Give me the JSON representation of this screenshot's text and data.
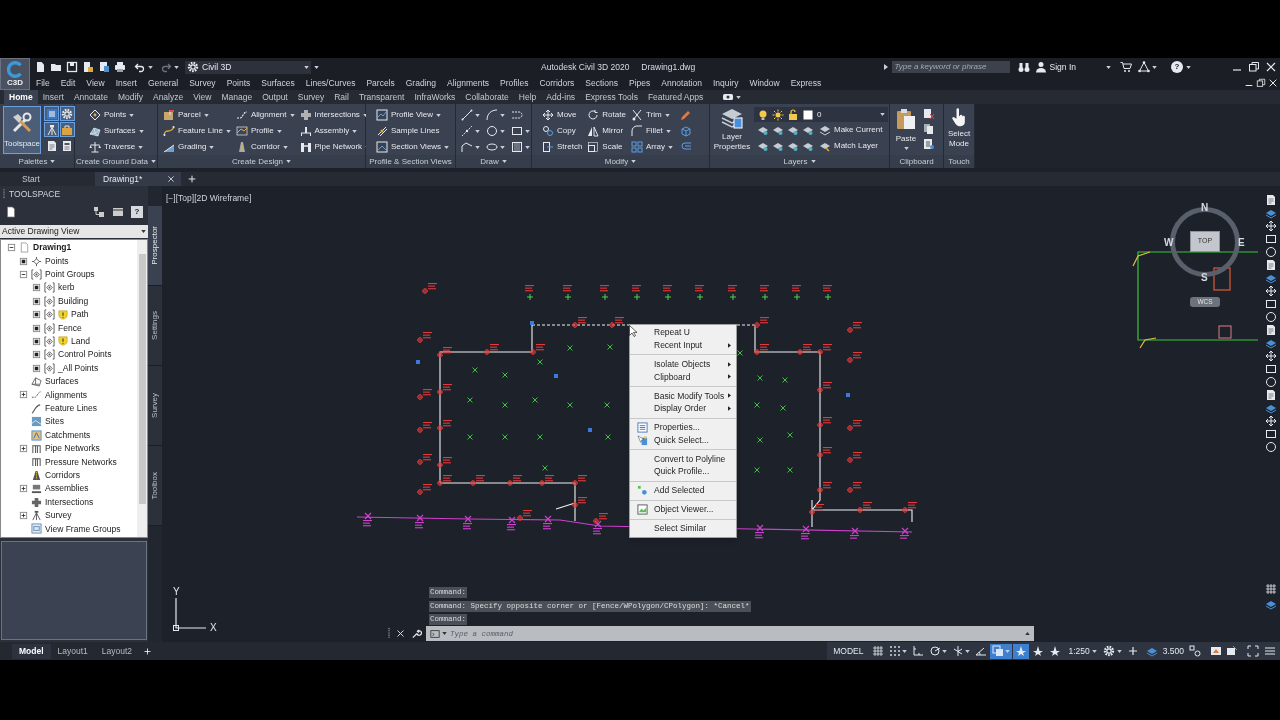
{
  "title_bar": {
    "app_button": "C3D",
    "workspace": "Civil 3D",
    "title": "Autodesk Civil 3D 2020",
    "document": "Drawing1.dwg",
    "search": {
      "placeholder": "Type a keyword or phrase"
    },
    "sign_in": "Sign In",
    "help": "?"
  },
  "menu_bar": [
    "File",
    "Edit",
    "View",
    "Insert",
    "General",
    "Survey",
    "Points",
    "Surfaces",
    "Lines/Curves",
    "Parcels",
    "Grading",
    "Alignments",
    "Profiles",
    "Corridors",
    "Sections",
    "Pipes",
    "Annotation",
    "Inquiry",
    "Window",
    "Express"
  ],
  "ribbon_tabs": [
    {
      "label": "Home",
      "selected": true
    },
    {
      "label": "Insert",
      "selected": false
    },
    {
      "label": "Annotate",
      "selected": false
    },
    {
      "label": "Modify",
      "selected": false
    },
    {
      "label": "Analyze",
      "selected": false
    },
    {
      "label": "View",
      "selected": false
    },
    {
      "label": "Manage",
      "selected": false
    },
    {
      "label": "Output",
      "selected": false
    },
    {
      "label": "Survey",
      "selected": false
    },
    {
      "label": "Rail",
      "selected": false
    },
    {
      "label": "Transparent",
      "selected": false
    },
    {
      "label": "InfraWorks",
      "selected": false
    },
    {
      "label": "Collaborate",
      "selected": false
    },
    {
      "label": "Help",
      "selected": false
    },
    {
      "label": "Add-ins",
      "selected": false
    },
    {
      "label": "Express Tools",
      "selected": false
    },
    {
      "label": "Featured Apps",
      "selected": false
    }
  ],
  "ribbon_panels": [
    {
      "kind": "palettes",
      "title": "Palettes",
      "menu": true,
      "large": {
        "label": "Toolspace",
        "selected": true
      },
      "small": [
        {
          "on": true
        },
        {
          "on": true
        },
        {
          "on": true
        },
        {
          "on": true
        },
        {
          "on": false
        },
        {
          "on": false
        }
      ]
    },
    {
      "kind": "columns",
      "title": "Create Ground Data",
      "menu": true,
      "columns": [
        [
          {
            "label": "Points",
            "menu": true
          },
          {
            "label": "Surfaces",
            "menu": true
          },
          {
            "label": "Traverse",
            "menu": true
          }
        ]
      ]
    },
    {
      "kind": "columns",
      "title": "Create Design",
      "menu": true,
      "columns": [
        [
          {
            "label": "Parcel",
            "menu": true
          },
          {
            "label": "Feature Line",
            "menu": true
          },
          {
            "label": "Grading",
            "menu": true
          }
        ],
        [
          {
            "label": "Alignment",
            "menu": true
          },
          {
            "label": "Profile",
            "menu": true
          },
          {
            "label": "Corridor",
            "menu": true
          }
        ],
        [
          {
            "label": "Intersections",
            "menu": true
          },
          {
            "label": "Assembly",
            "menu": true
          },
          {
            "label": "Pipe Network",
            "menu": true
          }
        ]
      ]
    },
    {
      "kind": "columns",
      "title": "Profile & Section Views",
      "menu": false,
      "columns": [
        [
          {
            "label": "Profile View",
            "menu": true
          },
          {
            "label": "Sample Lines",
            "menu": false
          },
          {
            "label": "Section Views",
            "menu": true
          }
        ]
      ]
    },
    {
      "kind": "draw",
      "title": "Draw",
      "menu": true
    },
    {
      "kind": "modify",
      "title": "Modify",
      "menu": true,
      "columns": [
        [
          {
            "label": "Move",
            "menu": false
          },
          {
            "label": "Copy",
            "menu": false
          },
          {
            "label": "Stretch",
            "menu": false
          }
        ],
        [
          {
            "label": "Rotate",
            "menu": false
          },
          {
            "label": "Mirror",
            "menu": false
          },
          {
            "label": "Scale",
            "menu": false
          }
        ],
        [
          {
            "label": "Trim",
            "menu": true
          },
          {
            "label": "Fillet",
            "menu": true
          },
          {
            "label": "Array",
            "menu": true
          }
        ]
      ]
    },
    {
      "kind": "layers",
      "title": "Layers",
      "menu": true,
      "large": {
        "label": "Layer Properties"
      },
      "current_layer": "0",
      "rows": [
        "Make Current",
        "Match Layer"
      ]
    },
    {
      "kind": "clipboard",
      "title": "Clipboard",
      "menu": false,
      "large": {
        "label": "Paste",
        "menu": true
      }
    },
    {
      "kind": "touch",
      "title": "Touch",
      "menu": false,
      "large": {
        "label": "Select Mode"
      }
    }
  ],
  "file_tabs": [
    {
      "label": "Start",
      "selected": false,
      "closable": false
    },
    {
      "label": "Drawing1*",
      "selected": true,
      "closable": true
    }
  ],
  "toolspace": {
    "title": "TOOLSPACE",
    "help": "?",
    "view": "Active Drawing View",
    "tree": [
      {
        "label": "Drawing1",
        "kind": "drawing",
        "expander": {
          "kind": "minus"
        },
        "children": [
          {
            "label": "Points",
            "kind": "points",
            "expander": {
              "kind": "filled"
            }
          },
          {
            "label": "Point Groups",
            "kind": "pointgroup",
            "expander": {
              "kind": "minus"
            },
            "children": [
              {
                "label": "kerb",
                "kind": "pointgroup",
                "expander": {
                  "kind": "filled"
                },
                "warning": false
              },
              {
                "label": "Building",
                "kind": "pointgroup",
                "expander": {
                  "kind": "filled"
                },
                "warning": false
              },
              {
                "label": "Path",
                "kind": "pointgroup",
                "expander": {
                  "kind": "filled"
                },
                "warning": true
              },
              {
                "label": "Fence",
                "kind": "pointgroup",
                "expander": {
                  "kind": "filled"
                },
                "warning": false
              },
              {
                "label": "Land",
                "kind": "pointgroup",
                "expander": {
                  "kind": "filled"
                },
                "warning": true
              },
              {
                "label": "Control Points",
                "kind": "pointgroup",
                "expander": {
                  "kind": "filled"
                },
                "warning": false
              },
              {
                "label": "_All Points",
                "kind": "pointgroup",
                "expander": {
                  "kind": "filled"
                },
                "warning": false
              }
            ]
          },
          {
            "label": "Surfaces",
            "kind": "surfaces"
          },
          {
            "label": "Alignments",
            "kind": "alignments",
            "expander": {
              "kind": "plus"
            }
          },
          {
            "label": "Feature Lines",
            "kind": "featurelines"
          },
          {
            "label": "Sites",
            "kind": "sites"
          },
          {
            "label": "Catchments",
            "kind": "catchments"
          },
          {
            "label": "Pipe Networks",
            "kind": "pipes",
            "expander": {
              "kind": "plus"
            }
          },
          {
            "label": "Pressure Networks",
            "kind": "pipes"
          },
          {
            "label": "Corridors",
            "kind": "corridors"
          },
          {
            "label": "Assemblies",
            "kind": "assemblies",
            "expander": {
              "kind": "plus"
            }
          },
          {
            "label": "Intersections",
            "kind": "intersections"
          },
          {
            "label": "Survey",
            "kind": "survey",
            "expander": {
              "kind": "plus"
            }
          },
          {
            "label": "View Frame Groups",
            "kind": "viewframes"
          }
        ]
      }
    ],
    "side_tabs": [
      {
        "label": "Prospector",
        "selected": true
      },
      {
        "label": "Settings",
        "selected": false
      },
      {
        "label": "Survey",
        "selected": false
      },
      {
        "label": "Toolbox",
        "selected": false
      }
    ]
  },
  "viewport": {
    "controls": [
      "[−]",
      "[Top]",
      "[2D Wireframe]"
    ]
  },
  "viewcube": {
    "north": "N",
    "west": "W",
    "east": "E",
    "south": "S",
    "face": "TOP",
    "ucs": "WCS"
  },
  "ucs_icon": {
    "y": "Y",
    "x": "X"
  },
  "context_menu": {
    "groups": [
      [
        {
          "label": "Repeat U",
          "kind": "plain"
        },
        {
          "label": "Recent Input",
          "kind": "submenu"
        }
      ],
      [
        {
          "label": "Isolate Objects",
          "kind": "submenu"
        },
        {
          "label": "Clipboard",
          "kind": "submenu"
        }
      ],
      [
        {
          "label": "Basic Modify Tools",
          "kind": "submenu"
        },
        {
          "label": "Display Order",
          "kind": "submenu"
        }
      ],
      [
        {
          "label": "Properties...",
          "kind": "icon"
        },
        {
          "label": "Quick Select...",
          "kind": "icon"
        }
      ],
      [
        {
          "label": "Convert to Polyline",
          "kind": "plain"
        },
        {
          "label": "Quick Profile...",
          "kind": "plain"
        }
      ],
      [
        {
          "label": "Add Selected",
          "kind": "icon"
        }
      ],
      [
        {
          "label": "Object Viewer...",
          "kind": "icon"
        }
      ],
      [
        {
          "label": "Select Similar",
          "kind": "plain"
        }
      ]
    ]
  },
  "command_line": {
    "history": [
      "Command:",
      "Command: Specify opposite corner or [Fence/WPolygon/CPolygon]: *Cancel*",
      "Command:"
    ],
    "input": {
      "placeholder": "Type a command"
    }
  },
  "layout_tabs": [
    {
      "label": "Model",
      "selected": true
    },
    {
      "label": "Layout1",
      "selected": false
    },
    {
      "label": "Layout2",
      "selected": false
    }
  ],
  "status_bar": {
    "model": "MODEL",
    "tools": [
      {
        "on": false,
        "menu": false
      },
      {
        "on": false,
        "menu": true
      },
      {
        "on": false,
        "menu": false
      },
      {
        "on": false,
        "menu": true
      },
      {
        "on": false,
        "menu": true
      },
      {
        "on": false,
        "menu": false
      },
      {
        "on": true,
        "menu": true
      },
      {
        "on": true,
        "menu": false
      },
      {
        "on": false,
        "menu": false
      },
      {
        "on": false,
        "menu": false
      }
    ],
    "scale": "1:250",
    "value": "3.500"
  }
}
